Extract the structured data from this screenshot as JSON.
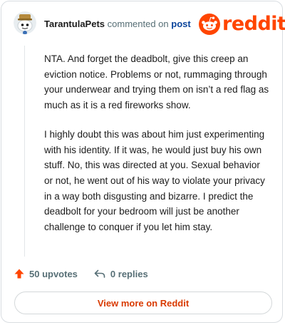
{
  "comment": {
    "author": "TarantulaPets",
    "action_text": "commented on",
    "target_text": "post",
    "paragraphs": [
      "NTA. And forget the deadbolt, give this creep an eviction notice. Problems or not, rummaging through your underwear and trying them on isn’t a red flag as much as it is a red fireworks show.",
      "I highly doubt this was about him just experimenting with his identity. If it was, he would just buy his own stuff. No, this was directed at you. Sexual behavior or not, he went out of his way to violate your privacy in a way both disgusting and bizarre. I predict the deadbolt for your bedroom will just be another challenge to conquer if you let him stay."
    ]
  },
  "brand": {
    "wordmark": "reddit",
    "accent_color": "#ff4500"
  },
  "actions": {
    "upvotes_label": "50 upvotes",
    "replies_label": "0 replies"
  },
  "footer": {
    "view_more_label": "View more on Reddit"
  },
  "icons": {
    "avatar": "snoo-avatar-icon",
    "logo": "reddit-logo-icon",
    "upvote": "upvote-arrow-icon",
    "reply": "reply-arrow-icon"
  }
}
